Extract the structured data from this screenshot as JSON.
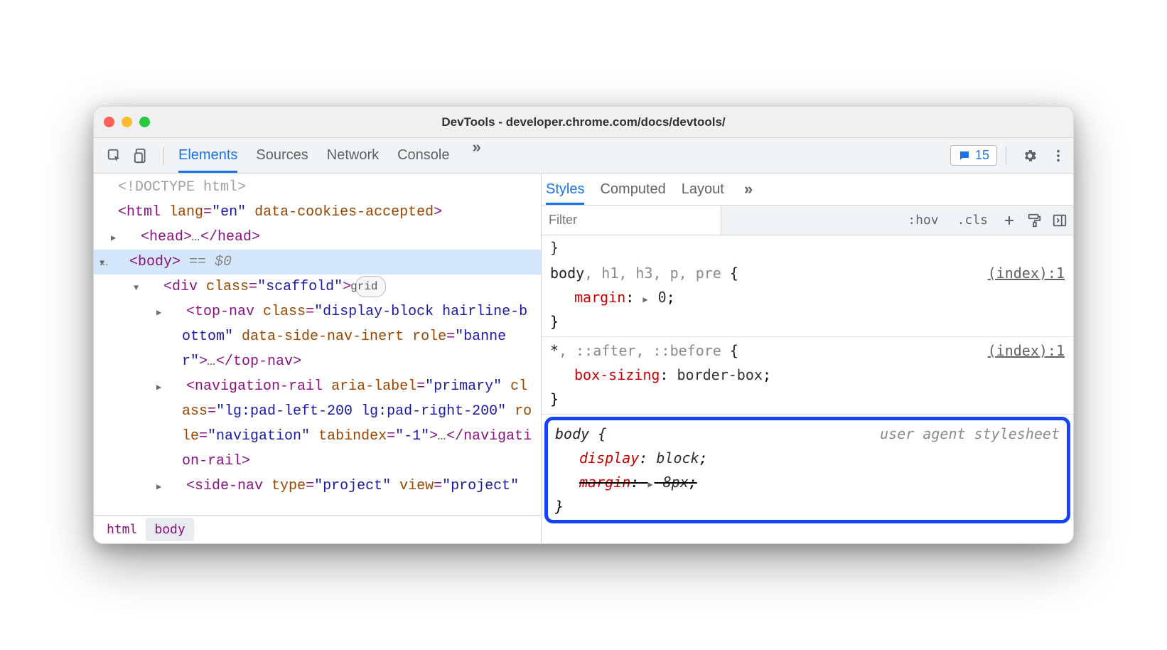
{
  "window": {
    "title": "DevTools - developer.chrome.com/docs/devtools/"
  },
  "toolbar": {
    "tabs": [
      "Elements",
      "Sources",
      "Network",
      "Console"
    ],
    "active_tab": "Elements",
    "more_label": "»",
    "issues_count": "15"
  },
  "dom": {
    "lines": [
      {
        "indent": 0,
        "arrow": "",
        "raw": "<!DOCTYPE html>",
        "cls": "doctype"
      },
      {
        "indent": 0,
        "arrow": "",
        "parts": [
          [
            "tagc",
            "<html "
          ],
          [
            "attrn",
            "lang"
          ],
          [
            "tagc",
            "="
          ],
          [
            "attrv",
            "\"en\""
          ],
          [
            "tagc",
            " "
          ],
          [
            "attrn",
            "data-cookies-accepted"
          ],
          [
            "tagc",
            ">"
          ]
        ]
      },
      {
        "indent": 1,
        "arrow": "rt",
        "parts": [
          [
            "tagc",
            "<head>"
          ],
          [
            "dots",
            "…"
          ],
          [
            "tagc",
            "</head>"
          ]
        ]
      },
      {
        "indent": 1,
        "arrow": "dn",
        "selected": true,
        "parts": [
          [
            "tagc",
            "<body>"
          ]
        ],
        "suffix": " == $0",
        "prefix": "…"
      },
      {
        "indent": 2,
        "arrow": "dn",
        "parts": [
          [
            "tagc",
            "<div "
          ],
          [
            "attrn",
            "class"
          ],
          [
            "tagc",
            "="
          ],
          [
            "attrv",
            "\"scaffold\""
          ],
          [
            "tagc",
            ">"
          ]
        ],
        "pill": "grid"
      },
      {
        "indent": 3,
        "arrow": "rt",
        "parts": [
          [
            "tagc",
            "<top-nav "
          ],
          [
            "attrn",
            "class"
          ],
          [
            "tagc",
            "="
          ],
          [
            "attrv",
            "\"display-block hairline-bottom\""
          ],
          [
            "tagc",
            " "
          ],
          [
            "attrn",
            "data-side-nav-inert"
          ],
          [
            "tagc",
            " "
          ],
          [
            "attrn",
            "role"
          ],
          [
            "tagc",
            "="
          ],
          [
            "attrv",
            "\"banner\""
          ],
          [
            "tagc",
            ">"
          ],
          [
            "dots",
            "…"
          ],
          [
            "tagc",
            "</top-nav>"
          ]
        ]
      },
      {
        "indent": 3,
        "arrow": "rt",
        "parts": [
          [
            "tagc",
            "<navigation-rail "
          ],
          [
            "attrn",
            "aria-label"
          ],
          [
            "tagc",
            "="
          ],
          [
            "attrv",
            "\"primary\""
          ],
          [
            "tagc",
            " "
          ],
          [
            "attrn",
            "class"
          ],
          [
            "tagc",
            "="
          ],
          [
            "attrv",
            "\"lg:pad-left-200 lg:pad-right-200\""
          ],
          [
            "tagc",
            " "
          ],
          [
            "attrn",
            "role"
          ],
          [
            "tagc",
            "="
          ],
          [
            "attrv",
            "\"navigation\""
          ],
          [
            "tagc",
            " "
          ],
          [
            "attrn",
            "tabindex"
          ],
          [
            "tagc",
            "="
          ],
          [
            "attrv",
            "\"-1\""
          ],
          [
            "tagc",
            ">"
          ],
          [
            "dots",
            "…"
          ],
          [
            "tagc",
            "</navigation-rail>"
          ]
        ]
      },
      {
        "indent": 3,
        "arrow": "rt",
        "parts": [
          [
            "tagc",
            "<side-nav "
          ],
          [
            "attrn",
            "type"
          ],
          [
            "tagc",
            "="
          ],
          [
            "attrv",
            "\"project\""
          ],
          [
            "tagc",
            " "
          ],
          [
            "attrn",
            "view"
          ],
          [
            "tagc",
            "="
          ],
          [
            "attrv",
            "\"project\""
          ]
        ]
      }
    ]
  },
  "breadcrumbs": [
    "html",
    "body"
  ],
  "styles": {
    "sub_tabs": [
      "Styles",
      "Computed",
      "Layout"
    ],
    "sub_tabs_active": "Styles",
    "more_label": "»",
    "filter_placeholder": "Filter",
    "hov": ":hov",
    "cls": ".cls",
    "rules": [
      {
        "selector_parts": [
          [
            "",
            "body"
          ],
          [
            "dim",
            ", h1, h3, p, pre "
          ],
          [
            "",
            "{"
          ]
        ],
        "source": "(index):1",
        "decls": [
          {
            "prop": "margin",
            "expand": true,
            "val": "0",
            "end": ";"
          }
        ]
      },
      {
        "selector_parts": [
          [
            "",
            "*"
          ],
          [
            "dim",
            ", ::after, ::before "
          ],
          [
            "",
            "{"
          ]
        ],
        "source": "(index):1",
        "decls": [
          {
            "prop": "box-sizing",
            "val": "border-box",
            "end": ";"
          }
        ]
      },
      {
        "highlight": true,
        "italic": true,
        "selector_parts": [
          [
            "",
            "body "
          ],
          [
            "",
            "{"
          ]
        ],
        "source_label": "user agent stylesheet",
        "decls": [
          {
            "prop": "display",
            "val": "block",
            "end": ";"
          },
          {
            "prop": "margin",
            "expand": true,
            "val": "8px",
            "end": ";",
            "strike": true
          }
        ]
      }
    ]
  }
}
